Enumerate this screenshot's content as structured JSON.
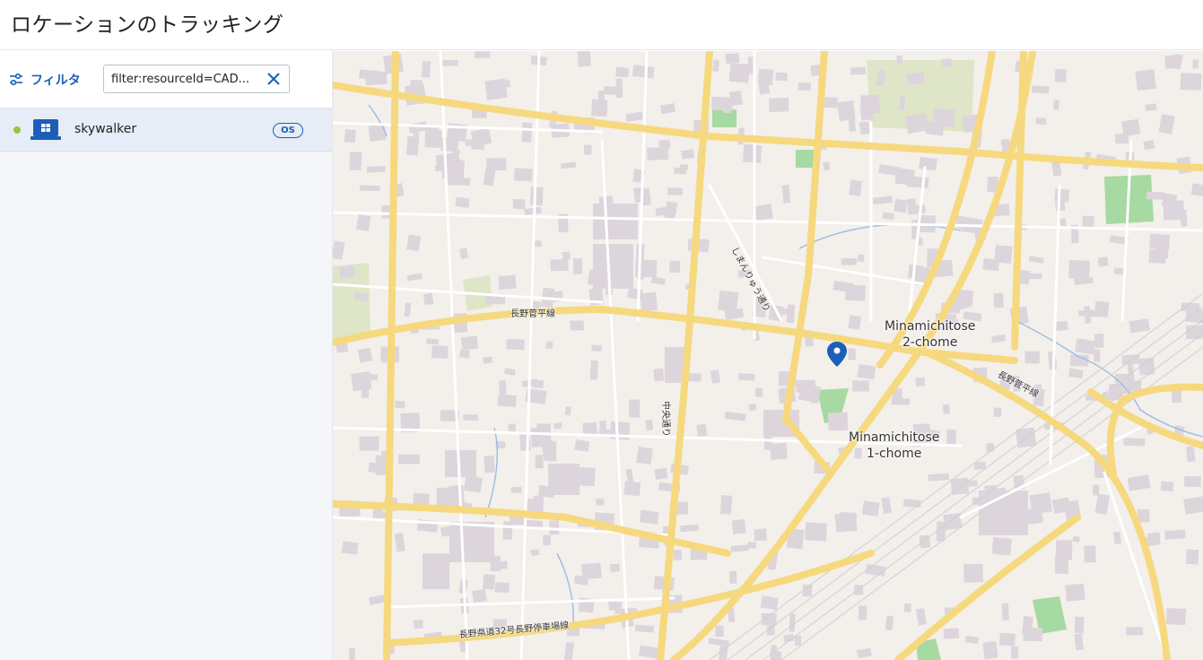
{
  "header": {
    "title": "ロケーションのトラッキング"
  },
  "sidebar": {
    "filter": {
      "button_label": "フィルタ",
      "input_value": "filter:resourceId=CAD..."
    },
    "devices": [
      {
        "name": "skywalker",
        "badge": "OS",
        "status_color": "#9bc53d"
      }
    ]
  },
  "map": {
    "area_labels": [
      {
        "line1": "Minamichitose",
        "line2": "2-chome"
      },
      {
        "line1": "Minamichitose",
        "line2": "1-chome"
      }
    ],
    "road_labels": [
      "長野菅平線",
      "長野菅平線",
      "中央通り",
      "しまんりゅう通り",
      "長野県道32号長野停車場線"
    ]
  },
  "colors": {
    "accent": "#1b5fb8",
    "road": "#f6d97e",
    "building": "#ddd5dc",
    "park": "#a7d9a2"
  }
}
